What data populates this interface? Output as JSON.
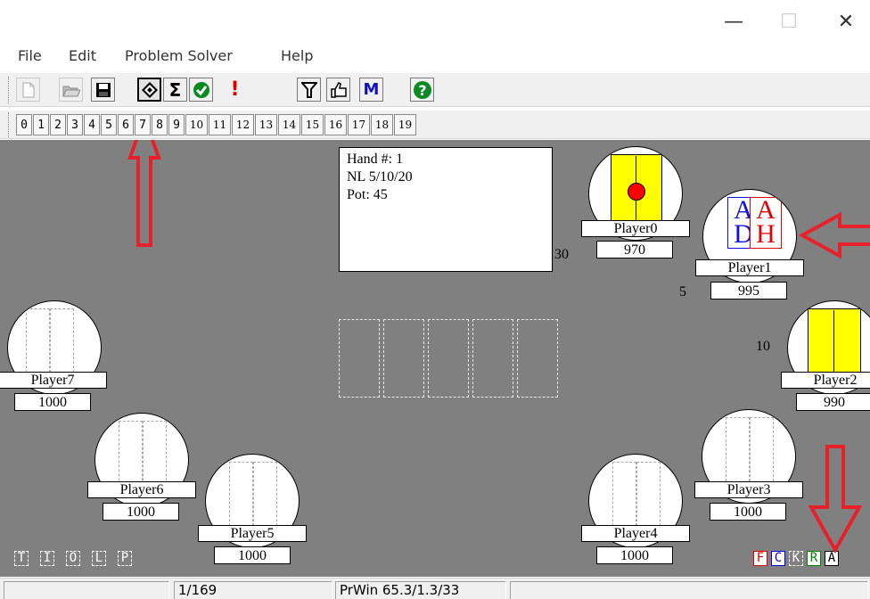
{
  "window": {
    "minimize": "—",
    "maximize": "☐",
    "close": "✕"
  },
  "menu": {
    "file": "File",
    "edit": "Edit",
    "problem_solver": "Problem Solver",
    "help": "Help"
  },
  "toolbar": {
    "sigma": "Σ",
    "alert": "!",
    "m": "M",
    "help": "?"
  },
  "hand_tabs": [
    "0",
    "1",
    "2",
    "3",
    "4",
    "5",
    "6",
    "7",
    "8",
    "9",
    "10",
    "11",
    "12",
    "13",
    "14",
    "15",
    "16",
    "17",
    "18",
    "19"
  ],
  "hand_info": {
    "line1": "Hand #: 1",
    "line2": "NL 5/10/20",
    "line3": "Pot: 45"
  },
  "players": [
    {
      "name": "Player0",
      "stack": "970",
      "bet": "30"
    },
    {
      "name": "Player1",
      "stack": "995",
      "bet": "5",
      "cards": [
        {
          "rank": "A",
          "suit": "D"
        },
        {
          "rank": "A",
          "suit": "H"
        }
      ]
    },
    {
      "name": "Player2",
      "stack": "990",
      "bet": "10"
    },
    {
      "name": "Player3",
      "stack": "1000"
    },
    {
      "name": "Player4",
      "stack": "1000"
    },
    {
      "name": "Player5",
      "stack": "1000"
    },
    {
      "name": "Player6",
      "stack": "1000"
    },
    {
      "name": "Player7",
      "stack": "1000"
    }
  ],
  "left_tags": [
    "T",
    "I",
    "O",
    "L",
    "P"
  ],
  "right_tags": [
    {
      "label": "F",
      "color": "#e00000"
    },
    {
      "label": "C",
      "color": "#0000e0"
    },
    {
      "label": "K",
      "color": "#ffffff"
    },
    {
      "label": "R",
      "color": "#008000"
    },
    {
      "label": "A",
      "color": "#000000"
    }
  ],
  "status": {
    "hand_count": "1/169",
    "prwin": "PrWin 65.3/1.3/33"
  },
  "colors": {
    "felt": "#808080",
    "arrow": "#e8202a",
    "button_card": "#ffff00",
    "dealer_chip": "#ff0000"
  }
}
